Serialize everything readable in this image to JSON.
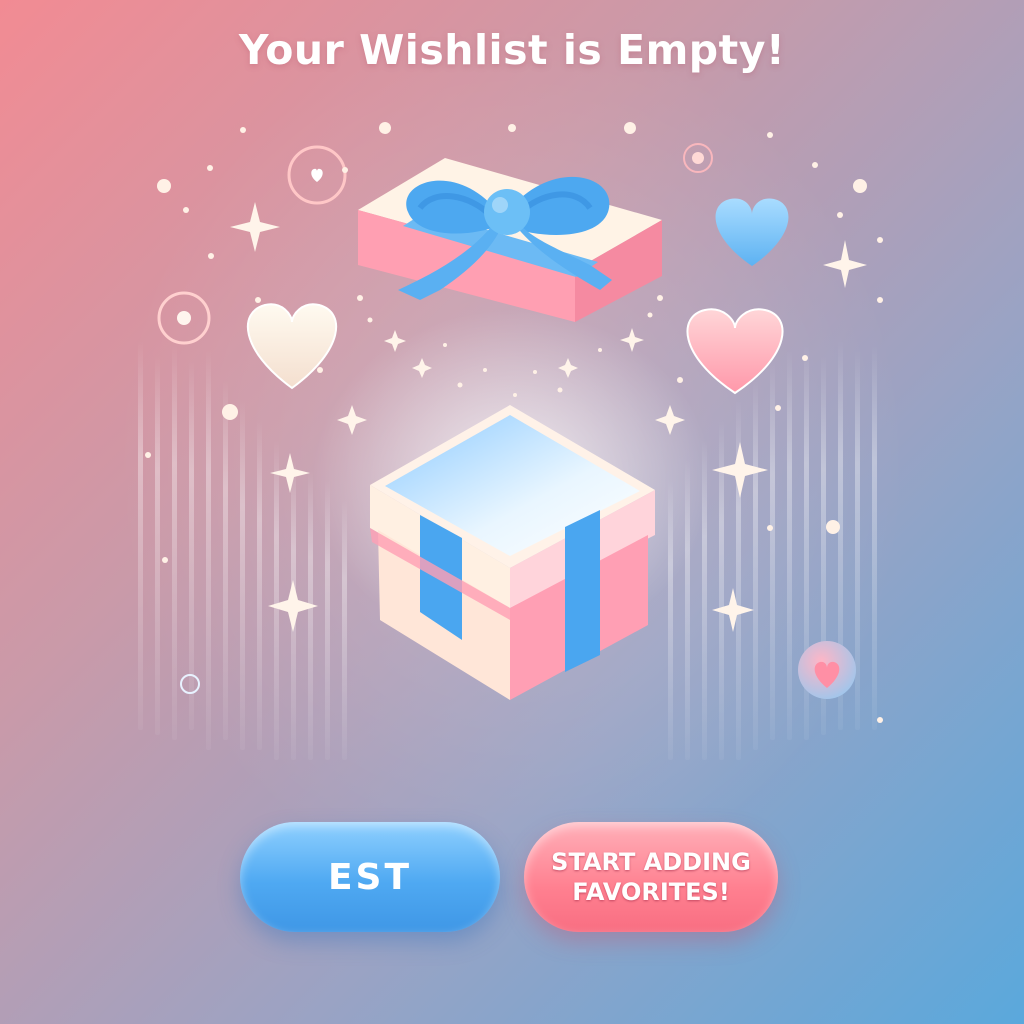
{
  "page": {
    "title": "Your Wishlist is Empty!"
  },
  "actions": {
    "left_button_label": "EST",
    "right_button_label": "START ADDING FAVORITES!"
  },
  "illustration": {
    "main_icon": "open-gift-box-icon",
    "lid_icon": "gift-lid-with-bow-icon",
    "decorations": [
      "heart-icon",
      "sparkle-icon",
      "circle-ring-icon",
      "dot-icon"
    ]
  },
  "colors": {
    "background_start": "#f28b93",
    "background_end": "#5aa8dc",
    "box_pink": "#ff9fb0",
    "box_cream": "#ffe9d6",
    "ribbon_blue": "#4aa6f0",
    "left_button": "#4fa9f2",
    "right_button": "#ff8090"
  }
}
